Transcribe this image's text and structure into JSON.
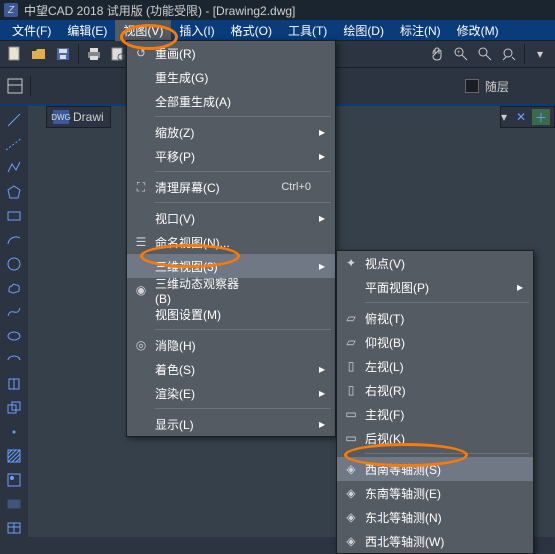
{
  "window": {
    "title": "中望CAD 2018 试用版 (功能受限) - [Drawing2.dwg]"
  },
  "menubar": {
    "file": "文件(F)",
    "edit": "编辑(E)",
    "view": "视图(V)",
    "insert": "插入(I)",
    "format": "格式(O)",
    "tools": "工具(T)",
    "draw": "绘图(D)",
    "annotate": "标注(N)",
    "modify": "修改(M)"
  },
  "toolbar2": {
    "layer_checkbox_label": "随层"
  },
  "doc_tab": {
    "label": "Drawi"
  },
  "view_menu": {
    "redraw": "重画(R)",
    "regen": "重生成(G)",
    "regen_all": "全部重生成(A)",
    "zoom": "缩放(Z)",
    "pan": "平移(P)",
    "clean_screen": "清理屏幕(C)",
    "clean_screen_shortcut": "Ctrl+0",
    "viewport": "视口(V)",
    "named_view": "命名视图(N)...",
    "view3d": "三维视图(3)",
    "orbit3d": "三维动态观察器(B)",
    "view_settings": "视图设置(M)",
    "hide": "消隐(H)",
    "shade": "着色(S)",
    "render": "渲染(E)",
    "display": "显示(L)"
  },
  "sub_menu": {
    "viewpoint": "视点(V)",
    "plan_view": "平面视图(P)",
    "top": "俯视(T)",
    "bottom": "仰视(B)",
    "left": "左视(L)",
    "right": "右视(R)",
    "front": "主视(F)",
    "back": "后视(K)",
    "sw_iso": "西南等轴测(S)",
    "se_iso": "东南等轴测(E)",
    "ne_iso": "东北等轴测(N)",
    "nw_iso": "西北等轴测(W)"
  }
}
